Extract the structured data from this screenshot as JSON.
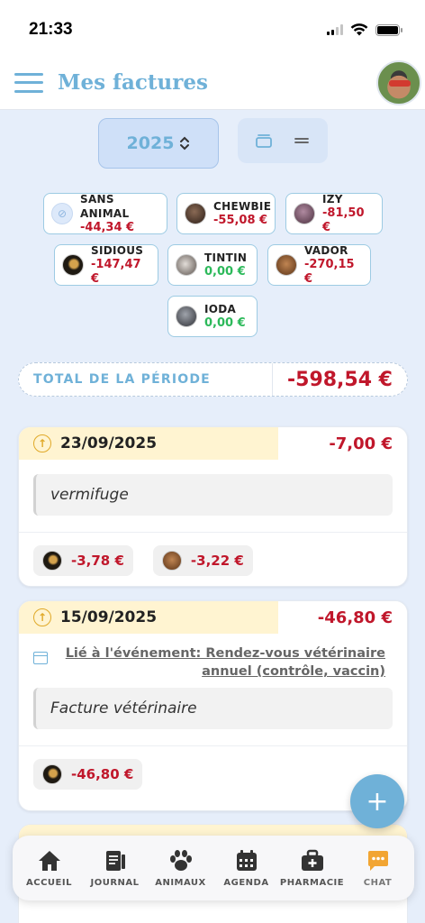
{
  "status_bar": {
    "time": "21:33"
  },
  "header": {
    "title": "Mes factures"
  },
  "year_select": {
    "value": "2025"
  },
  "animals": [
    {
      "name": "SANS ANIMAL",
      "amount": "-44,34 €",
      "kind": "neg",
      "color": "#dde9fa"
    },
    {
      "name": "CHEWBIE",
      "amount": "-55,08 €",
      "kind": "neg",
      "color": "#3b2a22"
    },
    {
      "name": "IZY",
      "amount": "-81,50 €",
      "kind": "neg",
      "color": "#6b4a5a"
    },
    {
      "name": "SIDIOUS",
      "amount": "-147,47 €",
      "kind": "neg",
      "color": "#2b2418"
    },
    {
      "name": "TINTIN",
      "amount": "0,00 €",
      "kind": "zero",
      "color": "#8a7f78"
    },
    {
      "name": "VADOR",
      "amount": "-270,15 €",
      "kind": "neg",
      "color": "#7a4b2a"
    },
    {
      "name": "IODA",
      "amount": "0,00 €",
      "kind": "zero",
      "color": "#4d4f55"
    }
  ],
  "total": {
    "label": "TOTAL DE LA PÉRIODE",
    "value": "-598,54 €"
  },
  "invoices": [
    {
      "date": "23/09/2025",
      "amount": "-7,00 €",
      "note": "vermifuge",
      "pets": [
        {
          "amount": "-3,78 €",
          "color": "#2b2418"
        },
        {
          "amount": "-3,22 €",
          "color": "#7a4b2a"
        }
      ]
    },
    {
      "date": "15/09/2025",
      "amount": "-46,80 €",
      "event_link": "Lié à l'événement: Rendez-vous vétérinaire annuel (contrôle, vaccin)",
      "note": "Facture vétérinaire",
      "pets": [
        {
          "amount": "-46,80 €",
          "color": "#2b2418"
        }
      ]
    }
  ],
  "fab": {
    "label": "+"
  },
  "nav": [
    {
      "label": "ACCUEIL",
      "icon": "home-icon"
    },
    {
      "label": "JOURNAL",
      "icon": "journal-icon"
    },
    {
      "label": "ANIMAUX",
      "icon": "paw-icon"
    },
    {
      "label": "AGENDA",
      "icon": "calendar-icon"
    },
    {
      "label": "PHARMACIE",
      "icon": "medkit-icon"
    },
    {
      "label": "CHAT",
      "icon": "chat-icon"
    }
  ],
  "colors": {
    "accent": "#6fb1d8",
    "negative": "#c0172b",
    "positive": "#2cb95a",
    "chat": "#f2a533"
  }
}
